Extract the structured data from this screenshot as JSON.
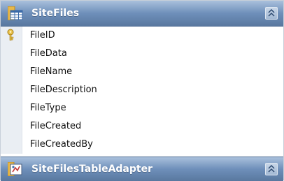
{
  "table": {
    "title": "SiteFiles",
    "icon": "table-icon",
    "collapse_icon": "chevron-up-double-icon"
  },
  "columns": [
    {
      "name": "FileID",
      "primary_key": true
    },
    {
      "name": "FileData",
      "primary_key": false
    },
    {
      "name": "FileName",
      "primary_key": false
    },
    {
      "name": "FileDescription",
      "primary_key": false
    },
    {
      "name": "FileType",
      "primary_key": false
    },
    {
      "name": "FileCreated",
      "primary_key": false
    },
    {
      "name": "FileCreatedBy",
      "primary_key": false
    }
  ],
  "adapter": {
    "title": "SiteFilesTableAdapter",
    "icon": "table-adapter-icon",
    "collapse_icon": "chevron-up-double-icon"
  },
  "colors": {
    "header_top": "#a9c0dc",
    "header_bottom": "#59789f",
    "gutter": "#eaeef3"
  }
}
